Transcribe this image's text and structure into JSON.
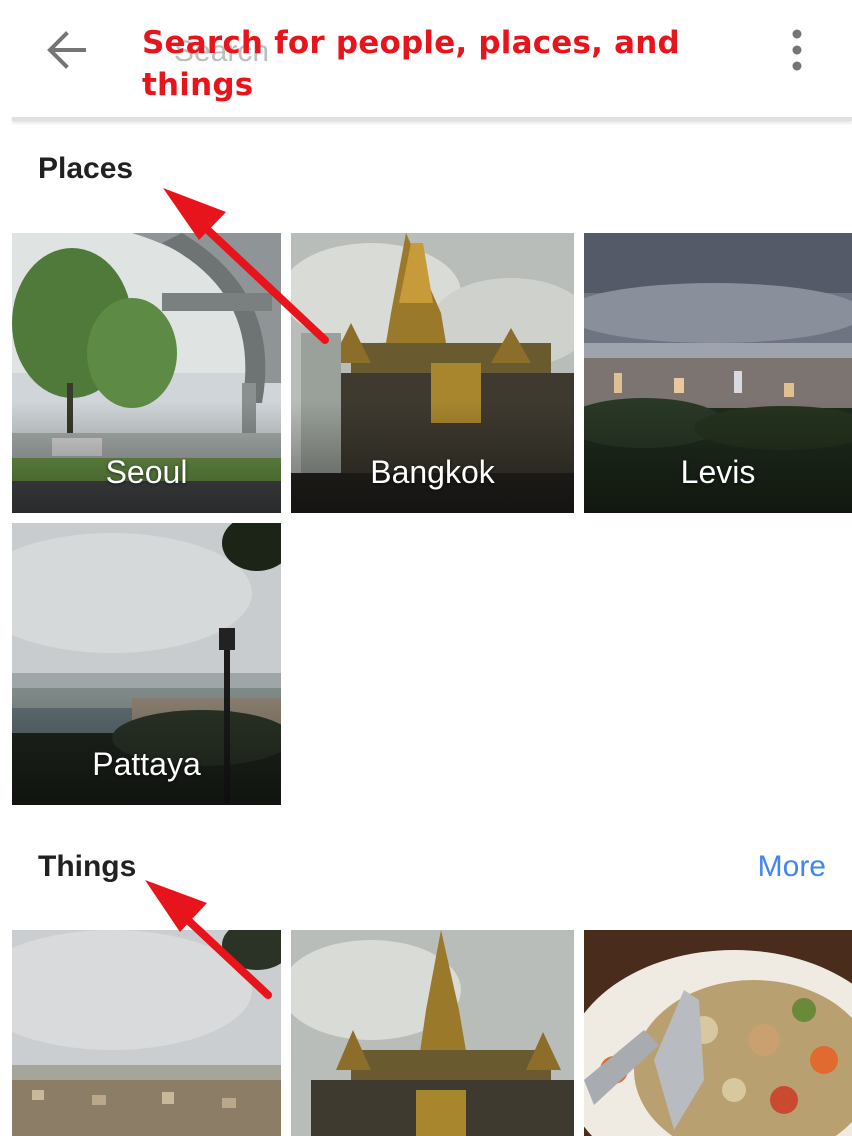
{
  "header": {
    "back_icon": "arrow-back-icon",
    "search_placeholder": "Search",
    "overflow_icon": "more-vert-icon"
  },
  "annotation": {
    "text": "Search for people, places, and things",
    "color": "#e8141c"
  },
  "sections": {
    "places": {
      "title": "Places",
      "tiles": [
        {
          "label": "Seoul"
        },
        {
          "label": "Bangkok"
        },
        {
          "label": "Levis"
        },
        {
          "label": "Pattaya"
        }
      ]
    },
    "things": {
      "title": "Things",
      "more_label": "More",
      "more_color": "#4285f4"
    }
  }
}
